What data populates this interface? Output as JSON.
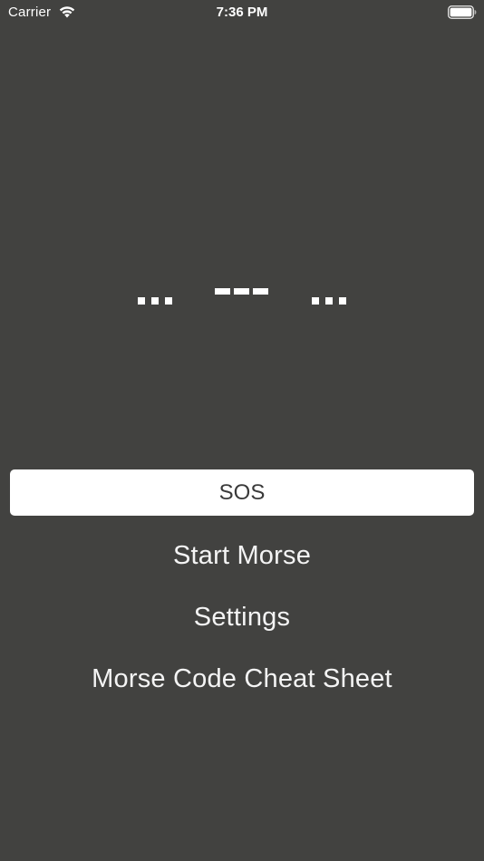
{
  "status_bar": {
    "carrier": "Carrier",
    "time": "7:36 PM"
  },
  "morse": {
    "pattern": [
      "...",
      "---",
      "..."
    ]
  },
  "buttons": {
    "sos_label": "SOS",
    "start_morse_label": "Start Morse",
    "settings_label": "Settings",
    "cheat_sheet_label": "Morse Code Cheat Sheet"
  },
  "colors": {
    "background": "#424240",
    "text": "#ffffff",
    "button_bg": "#ffffff",
    "button_text": "#3a3a3a"
  },
  "icons": {
    "wifi": "wifi-icon",
    "battery": "battery-icon"
  }
}
